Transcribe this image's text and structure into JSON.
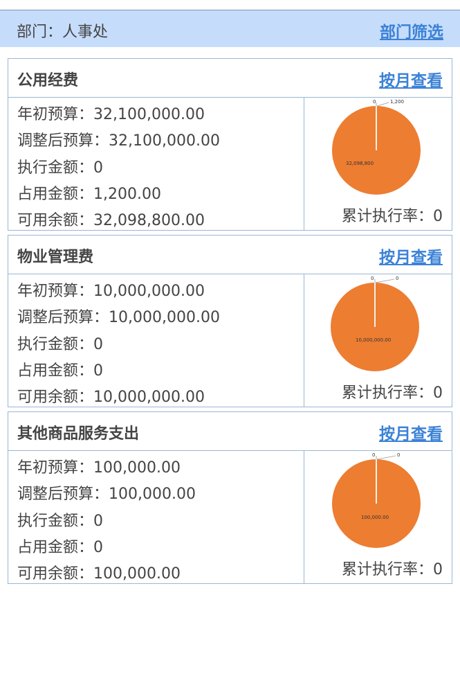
{
  "header": {
    "dept_label": "部门：人事处",
    "filter_link": "部门筛选"
  },
  "labels": {
    "budget_initial": "年初预算：",
    "budget_adjusted": "调整后预算：",
    "executed": "执行金额：",
    "occupied": "占用金额：",
    "available": "可用余额：",
    "rate": "累计执行率：",
    "month_link": "按月查看"
  },
  "colors": {
    "pie_fill": "#ed7d31",
    "link": "#3b82d6",
    "header_bg": "#c6dcfb"
  },
  "cards": [
    {
      "title": "公用经费",
      "budget_initial": "32,100,000.00",
      "budget_adjusted": "32,100,000.00",
      "executed": "0",
      "occupied": "1,200.00",
      "available": "32,098,800.00",
      "rate": "0",
      "pie": {
        "executed_label": "0",
        "occupied_label": "1,200",
        "available_label": "32,098,800"
      }
    },
    {
      "title": "物业管理费",
      "budget_initial": "10,000,000.00",
      "budget_adjusted": "10,000,000.00",
      "executed": "0",
      "occupied": "0",
      "available": "10,000,000.00",
      "rate": "0",
      "pie": {
        "executed_label": "0",
        "occupied_label": "0",
        "available_label": "10,000,000.00"
      }
    },
    {
      "title": "其他商品服务支出",
      "budget_initial": "100,000.00",
      "budget_adjusted": "100,000.00",
      "executed": "0",
      "occupied": "0",
      "available": "100,000.00",
      "rate": "0",
      "pie": {
        "executed_label": "0",
        "occupied_label": "0",
        "available_label": "100,000.00"
      }
    }
  ]
}
